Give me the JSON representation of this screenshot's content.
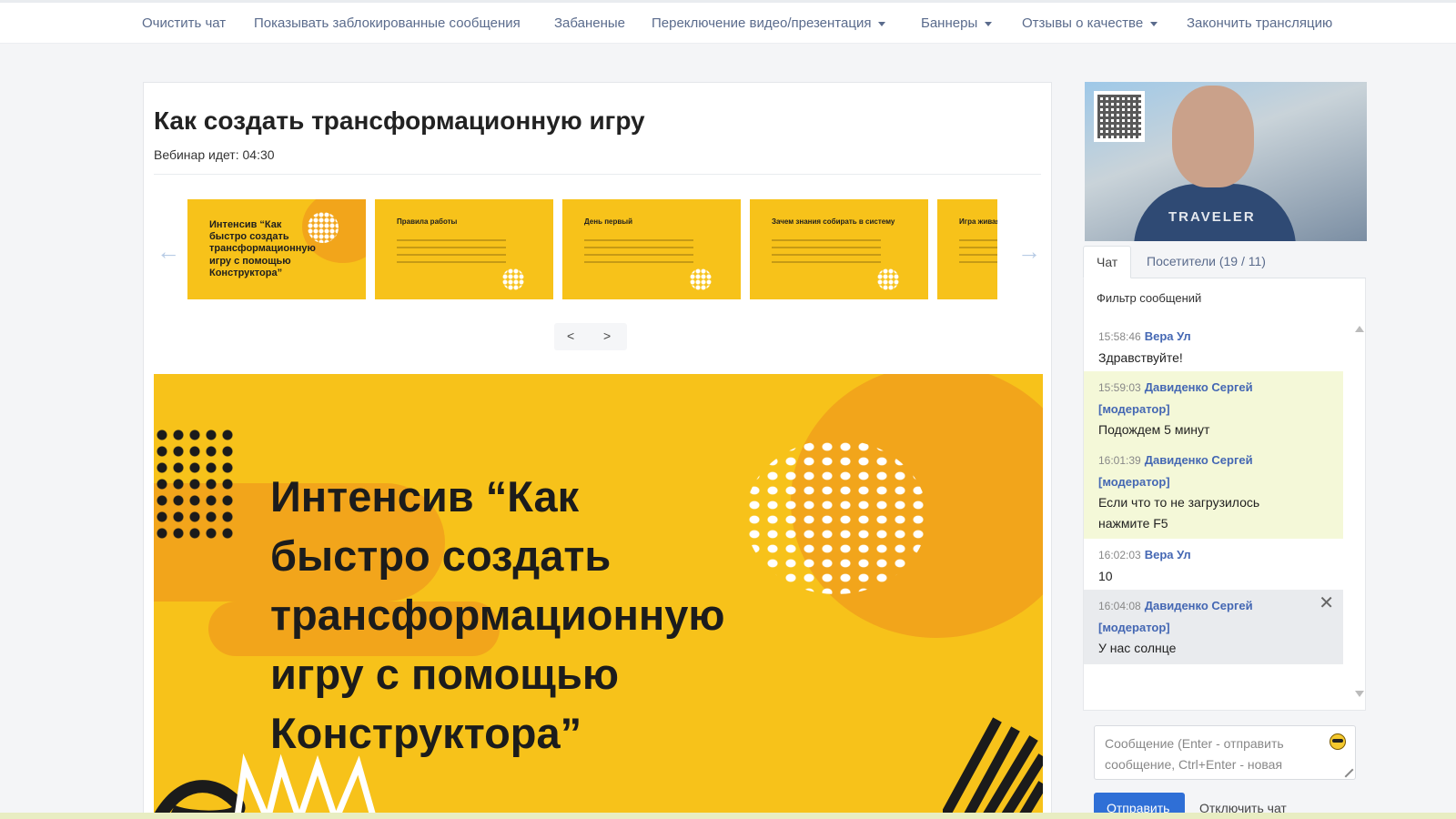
{
  "nav": {
    "items": [
      {
        "label": "Очистить чат",
        "dropdown": false
      },
      {
        "label": "Показывать заблокированные сообщения",
        "dropdown": false
      },
      {
        "label": "Забаненые",
        "dropdown": false
      },
      {
        "label": "Переключение видео/презентация",
        "dropdown": true
      },
      {
        "label": "Баннеры",
        "dropdown": true
      },
      {
        "label": "Отзывы о качестве",
        "dropdown": true
      },
      {
        "label": "Закончить трансляцию",
        "dropdown": false
      }
    ]
  },
  "webinar": {
    "title": "Как создать трансформационную игру",
    "status": "Вебинар идет: 04:30"
  },
  "thumbnails": [
    {
      "title": "Интенсив “Как быстро создать трансформационную игру с помощью Конструктора”"
    },
    {
      "title": "Правила работы"
    },
    {
      "title": "День первый"
    },
    {
      "title": "Зачем знания собирать в систему"
    },
    {
      "title": "Игра живая"
    }
  ],
  "pager": {
    "prev": "<",
    "next": ">"
  },
  "carousel_arrows": {
    "left": "←",
    "right": "→"
  },
  "slide": {
    "text": "Интенсив “Как\nбыстро создать\nтрансформационную\nигру с помощью\nКонструктора”"
  },
  "video": {
    "shirt_text": "TRAVELER"
  },
  "tabs": [
    {
      "label": "Чат",
      "active": true
    },
    {
      "label": "Посетители (19 / 11)",
      "active": false
    }
  ],
  "chat": {
    "filter_label": "Фильтр сообщений",
    "messages": [
      {
        "time": "15:58:46",
        "author": "Вера Ул",
        "role": "",
        "text": "Здравствуйте!"
      },
      {
        "time": "15:59:03",
        "author": "Давиденко Сергей",
        "role": "[модератор]",
        "text": "Подождем 5 минут"
      },
      {
        "time": "16:01:39",
        "author": "Давиденко Сергей",
        "role": "[модератор]",
        "text": "Если что то не загрузилось нажмите F5"
      },
      {
        "time": "16:02:03",
        "author": "Вера Ул",
        "role": "",
        "text": "10"
      },
      {
        "time": "16:04:08",
        "author": "Давиденко Сергей",
        "role": "[модератор]",
        "text": "У нас солнце"
      }
    ],
    "delete_symbol": "✕",
    "input_placeholder": "Сообщение (Enter - отправить сообщение, Ctrl+Enter - новая",
    "send_label": "Отправить",
    "disable_label": "Отключить чат"
  },
  "colors": {
    "accent": "#2f6fd6",
    "link": "#4467b3",
    "slide_yellow": "#f7c21a",
    "slide_orange": "#f2a51b",
    "moderator_bg": "#f4f8d8"
  },
  "icons": {
    "emoji": "smile-icon",
    "resize": "resize-handle-icon",
    "close": "close-icon",
    "scroll_up": "scroll-up-icon",
    "scroll_down": "scroll-down-icon"
  }
}
